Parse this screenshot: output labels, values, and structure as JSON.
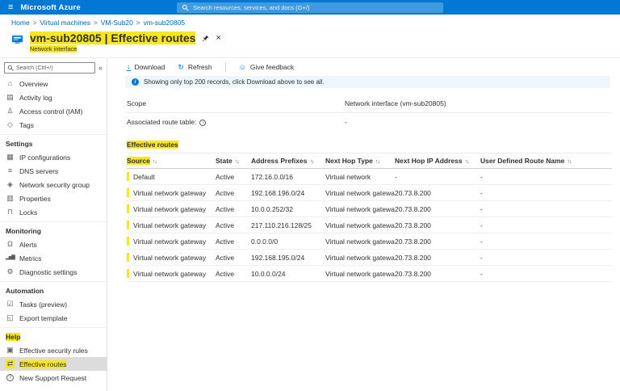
{
  "topbar": {
    "brand": "Microsoft Azure",
    "search_placeholder": "Search resources, services, and docs (G+/)"
  },
  "breadcrumb": {
    "items": [
      "Home",
      "Virtual machines",
      "VM-Sub20",
      "vm-sub20805"
    ]
  },
  "header": {
    "title": "vm-sub20805 | Effective routes",
    "subtitle": "Network interface"
  },
  "sidebar": {
    "search_placeholder": "Search (Ctrl+/)",
    "groups": [
      {
        "header": "",
        "items": [
          {
            "label": "Overview",
            "icon": "overview-icon",
            "glyph": "⌂"
          },
          {
            "label": "Activity log",
            "icon": "activity-log-icon",
            "glyph": "▤"
          },
          {
            "label": "Access control (IAM)",
            "icon": "access-control-icon",
            "glyph": "♙"
          },
          {
            "label": "Tags",
            "icon": "tags-icon",
            "glyph": "◇"
          }
        ]
      },
      {
        "header": "Settings",
        "items": [
          {
            "label": "IP configurations",
            "icon": "ip-configurations-icon",
            "glyph": "▦"
          },
          {
            "label": "DNS servers",
            "icon": "dns-servers-icon",
            "glyph": "≡"
          },
          {
            "label": "Network security group",
            "icon": "network-security-group-icon",
            "glyph": "◈"
          },
          {
            "label": "Properties",
            "icon": "properties-icon",
            "glyph": "▥"
          },
          {
            "label": "Locks",
            "icon": "locks-icon",
            "glyph": "⊓"
          }
        ]
      },
      {
        "header": "Monitoring",
        "items": [
          {
            "label": "Alerts",
            "icon": "alerts-icon",
            "glyph": "Ω"
          },
          {
            "label": "Metrics",
            "icon": "metrics-icon",
            "glyph": "▂▅▇"
          },
          {
            "label": "Diagnostic settings",
            "icon": "diagnostic-settings-icon",
            "glyph": "⚙"
          }
        ]
      },
      {
        "header": "Automation",
        "items": [
          {
            "label": "Tasks (preview)",
            "icon": "tasks-icon",
            "glyph": "☑"
          },
          {
            "label": "Export template",
            "icon": "export-template-icon",
            "glyph": "◱"
          }
        ]
      },
      {
        "header": "Help",
        "items": [
          {
            "label": "Effective security rules",
            "icon": "effective-security-rules-icon",
            "glyph": "▣"
          },
          {
            "label": "Effective routes",
            "icon": "effective-routes-icon",
            "glyph": "⇄",
            "selected": true
          },
          {
            "label": "New Support Request",
            "icon": "support-request-icon",
            "glyph": "?"
          }
        ]
      }
    ]
  },
  "toolbar": {
    "download": "Download",
    "refresh": "Refresh",
    "feedback": "Give feedback"
  },
  "banner": {
    "text": "Showing only top 200 records, click Download above to see all."
  },
  "details": {
    "scope_label": "Scope",
    "scope_value": "Network interface (vm-sub20805)",
    "route_table_label": "Associated route table:",
    "route_table_value": "-"
  },
  "routes": {
    "caption": "Effective routes",
    "columns": [
      "Source",
      "State",
      "Address Prefixes",
      "Next Hop Type",
      "Next Hop IP Address",
      "User Defined Route Name"
    ],
    "rows": [
      [
        "Default",
        "Active",
        "172.16.0.0/16",
        "Virtual network",
        "-",
        "-"
      ],
      [
        "Virtual network gateway",
        "Active",
        "192.168.196.0/24",
        "Virtual network gateway",
        "20.73.8.200",
        "-"
      ],
      [
        "Virtual network gateway",
        "Active",
        "10.0.0.252/32",
        "Virtual network gateway",
        "20.73.8.200",
        "-"
      ],
      [
        "Virtual network gateway",
        "Active",
        "217.110.216.128/25",
        "Virtual network gateway",
        "20.73.8.200",
        "-"
      ],
      [
        "Virtual network gateway",
        "Active",
        "0.0.0.0/0",
        "Virtual network gateway",
        "20.73.8.200",
        "-"
      ],
      [
        "Virtual network gateway",
        "Active",
        "192.168.195.0/24",
        "Virtual network gateway",
        "20.73.8.200",
        "-"
      ],
      [
        "Virtual network gateway",
        "Active",
        "10.0.0.0/24",
        "Virtual network gateway",
        "20.73.8.200",
        "-"
      ]
    ]
  },
  "icons": {
    "menu": "≡",
    "collapse": "«",
    "close": "×",
    "sort": "↑↓",
    "download": "↓",
    "refresh": "↻",
    "feedback": "☺",
    "info": "i"
  },
  "colors": {
    "topbar": "#0078d4",
    "link": "#0065b3",
    "highlight": "#f8e71c",
    "banner_bg": "#eff6fc",
    "selected_bg": "#dcdcdc"
  }
}
